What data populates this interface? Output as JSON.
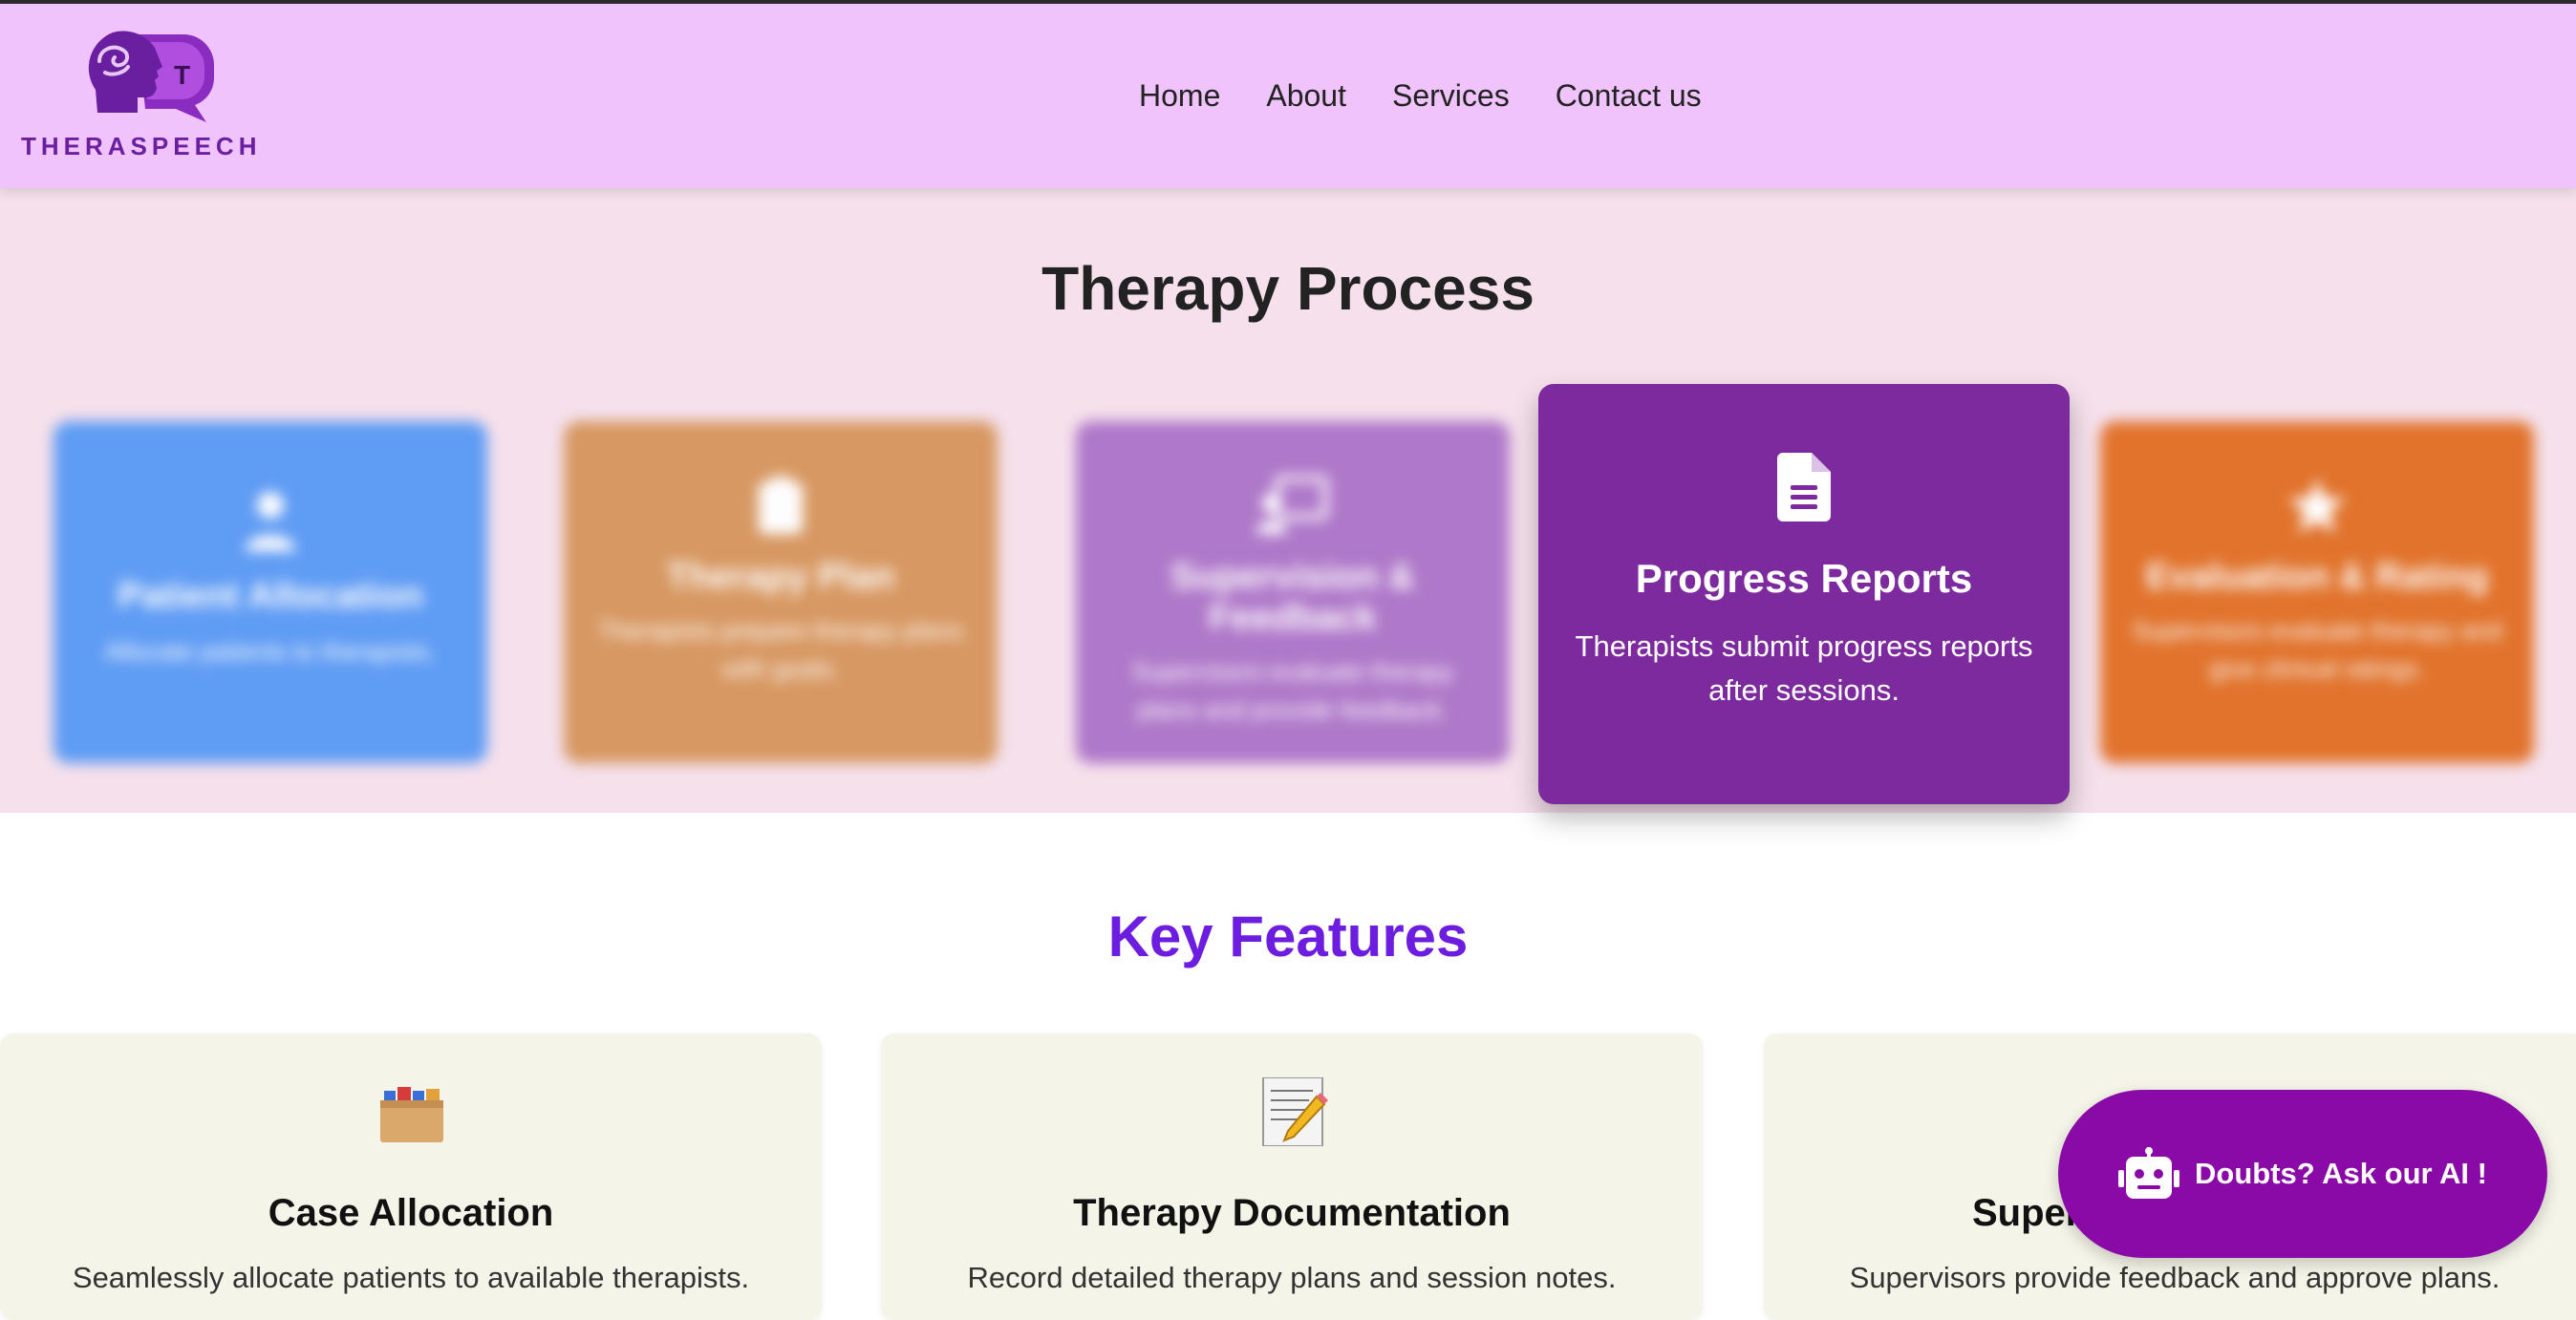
{
  "brand": {
    "name": "THERASPEECH",
    "mark_letter": "T"
  },
  "nav": {
    "items": [
      {
        "label": "Home"
      },
      {
        "label": "About"
      },
      {
        "label": "Services"
      },
      {
        "label": "Contact us"
      }
    ]
  },
  "process": {
    "title": "Therapy Process",
    "cards": [
      {
        "title": "Patient Allocation",
        "desc": "Allocate patients to therapists.",
        "icon": "user-icon",
        "color": "#5899f5"
      },
      {
        "title": "Therapy Plan",
        "desc": "Therapists prepare therapy plans with goals.",
        "icon": "clipboard-icon",
        "color": "#d6955c"
      },
      {
        "title": "Supervision & Feedback",
        "desc": "Supervisors evaluate therapy plans and provide feedback.",
        "icon": "chat-teacher-icon",
        "color": "#ac73c8"
      },
      {
        "title": "Progress Reports",
        "desc_line1": "Therapists submit progress reports",
        "desc_line2": "after sessions.",
        "icon": "document-icon",
        "color": "#7d2a9e"
      },
      {
        "title": "Evaluation & Rating",
        "desc": "Supervisors evaluate therapy and give clinical ratings.",
        "icon": "star-icon",
        "color": "#e06e23"
      }
    ]
  },
  "features": {
    "title": "Key Features",
    "cards": [
      {
        "title": "Case Allocation",
        "desc": "Seamlessly allocate patients to available therapists.",
        "icon": "card-file-box-icon"
      },
      {
        "title": "Therapy Documentation",
        "desc": "Record detailed therapy plans and session notes.",
        "icon": "memo-pencil-icon"
      },
      {
        "title": "Supervision",
        "title_visible": "Super",
        "desc": "Supervisors provide feedback and approve plans.",
        "icon": "supervision-icon"
      }
    ]
  },
  "chat": {
    "label": "Doubts? Ask our AI !",
    "icon": "robot-icon"
  },
  "colors": {
    "header_bg": "#f0c3fc",
    "process_bg": "#f5e0eb",
    "features_title": "#6d1de0",
    "brand": "#6a1fa0",
    "chat_bg": "#8a0aa8"
  }
}
